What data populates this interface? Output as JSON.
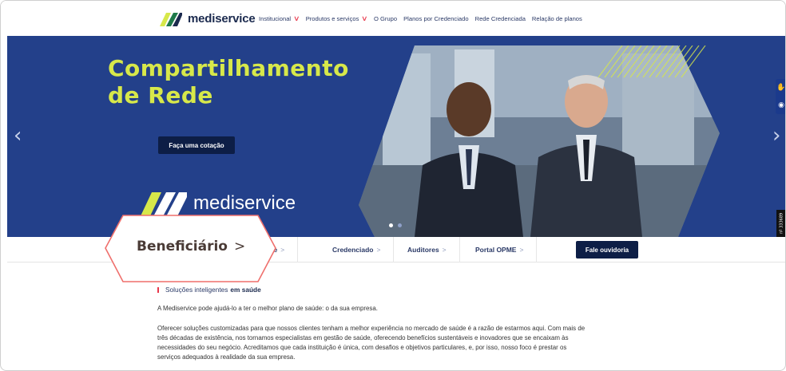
{
  "brand": {
    "name": "mediservice",
    "colors": {
      "navy": "#1b2a4e",
      "accent": "#d7e84a",
      "red": "#e8374b",
      "hero": "#23408a"
    }
  },
  "nav": {
    "items": [
      {
        "label": "Institucional",
        "has_dropdown": true
      },
      {
        "label": "Produtos e serviços",
        "has_dropdown": true
      },
      {
        "label": "O Grupo",
        "has_dropdown": false
      },
      {
        "label": "Planos por Credenciado",
        "has_dropdown": false
      },
      {
        "label": "Rede Credenciada",
        "has_dropdown": false
      },
      {
        "label": "Relação de planos",
        "has_dropdown": false
      }
    ]
  },
  "hero": {
    "title_line1": "Compartilhamento",
    "title_line2": "de Rede",
    "cta_label": "Faça uma cotação",
    "brand_text": "mediservice",
    "slide_count": 2,
    "active_slide": 1
  },
  "tabs": {
    "cliente": "liente",
    "credenciado": "Credenciado",
    "auditores": "Auditores",
    "portal": "Portal OPME",
    "chevron": ">",
    "ouvidoria": "Fale ouvidoria"
  },
  "callout": {
    "label": "Beneficiário",
    "chevron": ">"
  },
  "side": {
    "seal_text": "nº 333689"
  },
  "content": {
    "kicker_normal": "Soluções inteligentes",
    "kicker_bold": "em saúde",
    "paragraph1": "A Mediservice pode ajudá-lo a ter o melhor plano de saúde: o da sua empresa.",
    "paragraph2_lines": [
      "Oferecer soluções customizadas para que nossos clientes tenham a melhor experiência no mercado de saúde é a razão de estarmos aqui. Com mais de",
      "três décadas de existência, nos tornamos especialistas em gestão de saúde, oferecendo benefícios sustentáveis e inovadores que se encaixam às",
      "necessidades do seu negócio. Acreditamos que cada instituição é única, com desafios e objetivos particulares, e, por isso, nosso foco é prestar os",
      "serviços adequados à realidade da sua empresa."
    ]
  }
}
